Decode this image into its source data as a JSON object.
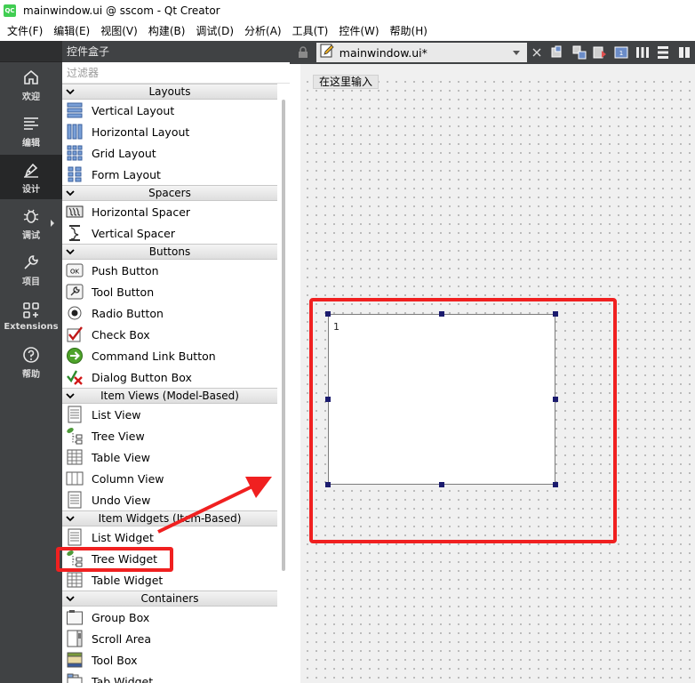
{
  "window": {
    "title": "mainwindow.ui @ sscom - Qt Creator",
    "app_icon_text": "QC"
  },
  "menu": [
    "文件(F)",
    "编辑(E)",
    "视图(V)",
    "构建(B)",
    "调试(D)",
    "分析(A)",
    "工具(T)",
    "控件(W)",
    "帮助(H)"
  ],
  "modes": [
    {
      "label": "欢迎",
      "icon": "home-icon"
    },
    {
      "label": "编辑",
      "icon": "edit-icon"
    },
    {
      "label": "设计",
      "icon": "design-pen-icon",
      "active": true
    },
    {
      "label": "调试",
      "icon": "debug-bug-icon"
    },
    {
      "label": "项目",
      "icon": "wrench-icon"
    },
    {
      "label": "Extensions",
      "icon": "extensions-icon"
    },
    {
      "label": "帮助",
      "icon": "help-icon"
    }
  ],
  "widget_box": {
    "title": "控件盒子",
    "filter_placeholder": "过滤器",
    "categories": [
      {
        "name": "Layouts",
        "items": [
          "Vertical Layout",
          "Horizontal Layout",
          "Grid Layout",
          "Form Layout"
        ]
      },
      {
        "name": "Spacers",
        "items": [
          "Horizontal Spacer",
          "Vertical Spacer"
        ]
      },
      {
        "name": "Buttons",
        "items": [
          "Push Button",
          "Tool Button",
          "Radio Button",
          "Check Box",
          "Command Link Button",
          "Dialog Button Box"
        ]
      },
      {
        "name": "Item Views (Model-Based)",
        "items": [
          "List View",
          "Tree View",
          "Table View",
          "Column View",
          "Undo View"
        ]
      },
      {
        "name": "Item Widgets (Item-Based)",
        "items": [
          "List Widget",
          "Tree Widget",
          "Table Widget"
        ]
      },
      {
        "name": "Containers",
        "items": [
          "Group Box",
          "Scroll Area",
          "Tool Box",
          "Tab Widget"
        ]
      }
    ]
  },
  "editor": {
    "document_title": "mainwindow.ui*",
    "menu_placeholder": "在这里输入",
    "tree_widget_header": "1"
  },
  "colors": {
    "annotation": "#f02020",
    "mode_bar": "#404244",
    "selection_handle": "#1b1b6e"
  }
}
